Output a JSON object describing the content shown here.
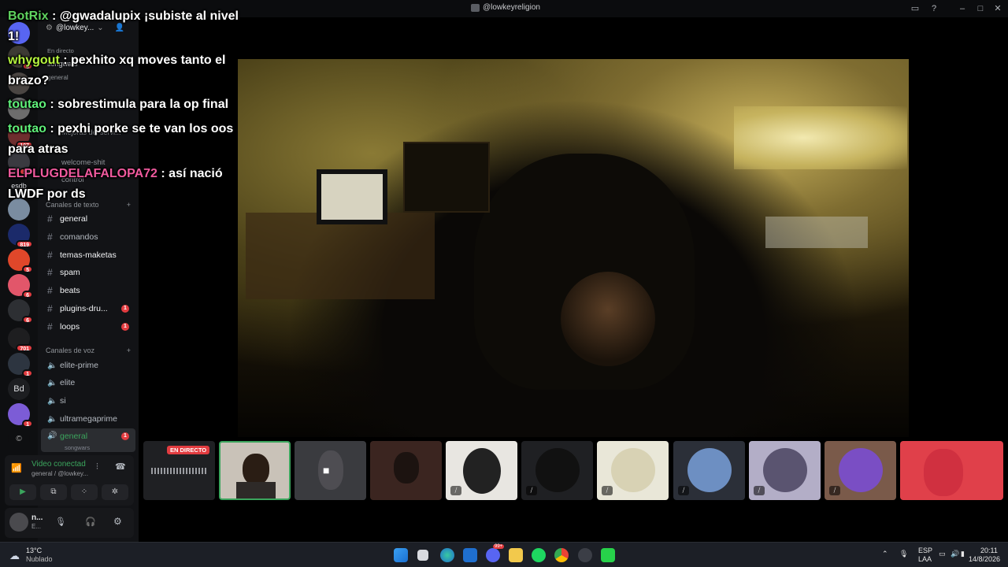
{
  "window": {
    "title": "@lowkeyreligion"
  },
  "server": {
    "name": "@lowkey...",
    "live_label": "En directo",
    "voice_channel": "songwars",
    "voice_sub": "general",
    "mejoras": "Mejoras del servi...",
    "welcome": "welcome-shit",
    "control": "control"
  },
  "rail": {
    "esdb_label": "esdb",
    "bd_label": "Bd",
    "badges": [
      "3",
      "107",
      "10",
      "819",
      "5",
      "6",
      "6",
      "701",
      "1",
      "1"
    ]
  },
  "text_category": "Canales de texto",
  "text_channels": [
    {
      "label": "general",
      "badge": ""
    },
    {
      "label": "comandos",
      "badge": ""
    },
    {
      "label": "temas-maketas",
      "badge": ""
    },
    {
      "label": "spam",
      "badge": ""
    },
    {
      "label": "beats",
      "badge": ""
    },
    {
      "label": "plugins-dru...",
      "badge": "1"
    },
    {
      "label": "loops",
      "badge": "1"
    }
  ],
  "voice_category": "Canales de voz",
  "voice_channels": [
    {
      "label": "elite-prime"
    },
    {
      "label": "elite"
    },
    {
      "label": "si"
    },
    {
      "label": "ultramegaprime"
    },
    {
      "label": "general",
      "sub": "songwars",
      "badge": "1"
    }
  ],
  "voice_panel": {
    "status": "Video conectad",
    "location": "general / @lowkey..."
  },
  "user_panel": {
    "name": "n...",
    "status": "E..."
  },
  "chat": [
    {
      "user": "BotRix",
      "sep": " : ",
      "text": "@gwadalupix ¡subiste al nivel 1!",
      "color": "#5fd35f"
    },
    {
      "user": "whygout",
      "sep": " : ",
      "text": "pexhito xq moves tanto el brazo?",
      "color": "#b6f53f"
    },
    {
      "user": "toutao",
      "sep": " : ",
      "text": "sobrestimula para la op final",
      "color": "#5ff07a"
    },
    {
      "user": "toutao",
      "sep": " : ",
      "text": "pexhi porke se te van los oos para atras",
      "color": "#5ff07a"
    },
    {
      "user": "ELPLUGDELAFALOPA72",
      "sep": " : ",
      "text": "así nació LWDF por ds",
      "color": "#f05a9e"
    }
  ],
  "stream_tile_label": "EN DIRECTO",
  "taskbar": {
    "weather_temp": "13°C",
    "weather_desc": "Nublado",
    "lang1": "ESP",
    "lang2": "LAA",
    "time": "20:11",
    "date": "14/8/2026",
    "discord_badge": "99+"
  }
}
